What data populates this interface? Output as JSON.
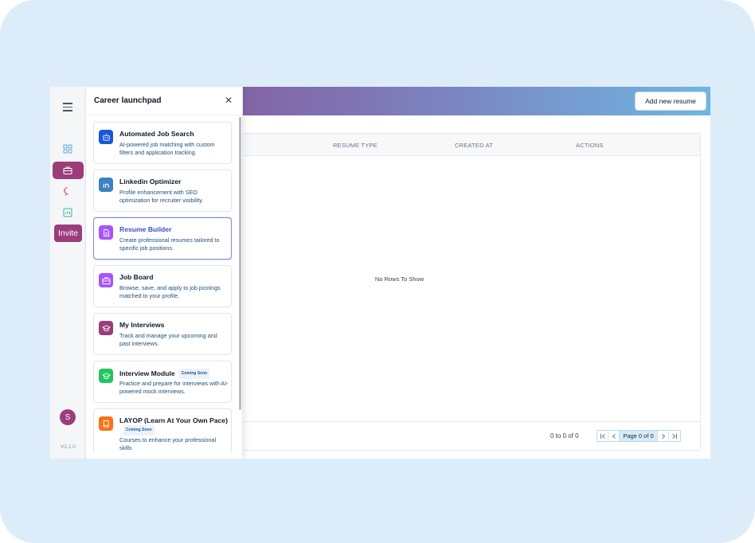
{
  "rail": {
    "invite_label": "Invite",
    "avatar_initial": "S",
    "version": "V2.1.0"
  },
  "header": {
    "add_button_label": "Add new resume"
  },
  "drawer": {
    "title": "Career launchpad",
    "close_glyph": "✕",
    "items": [
      {
        "title": "Automated Job Search",
        "badge": "",
        "desc": "AI-powered job matching with custom filters and application tracking.",
        "color": "#1a56db",
        "icon": "robot-icon"
      },
      {
        "title": "Linkedin Optimizer",
        "badge": "",
        "desc": "Profile enhancement with SEO optimization for recruiter visibility.",
        "color": "#3b82c4",
        "icon": "linkedin-icon"
      },
      {
        "title": "Resume Builder",
        "badge": "",
        "desc": "Create professional resumes tailored to specific job positions.",
        "color": "#a855f7",
        "icon": "document-icon"
      },
      {
        "title": "Job Board",
        "badge": "",
        "desc": "Browse, save, and apply to job postings matched to your profile.",
        "color": "#a855f7",
        "icon": "briefcase-icon"
      },
      {
        "title": "My Interviews",
        "badge": "",
        "desc": "Track and manage your upcoming and past interviews.",
        "color": "#9c3d7b",
        "icon": "graduation-cap-icon"
      },
      {
        "title": "Interview Module",
        "badge": "Coming Soon",
        "desc": "Practice and prepare for interviews with AI-powered mock interviews.",
        "color": "#22c55e",
        "icon": "graduation-cap-icon"
      },
      {
        "title": "LAYOP (Learn At Your Own Pace)",
        "badge": "Coming Soon",
        "desc": "Courses to enhance your professional skills",
        "color": "#f97316",
        "icon": "book-icon"
      }
    ]
  },
  "table": {
    "columns": [
      "RESUME TYPE",
      "CREATED AT",
      "ACTIONS"
    ],
    "empty_message": "No Rows To Show",
    "footer_count": "0 to 0 of 0",
    "page_label": "Page 0 of 0"
  }
}
